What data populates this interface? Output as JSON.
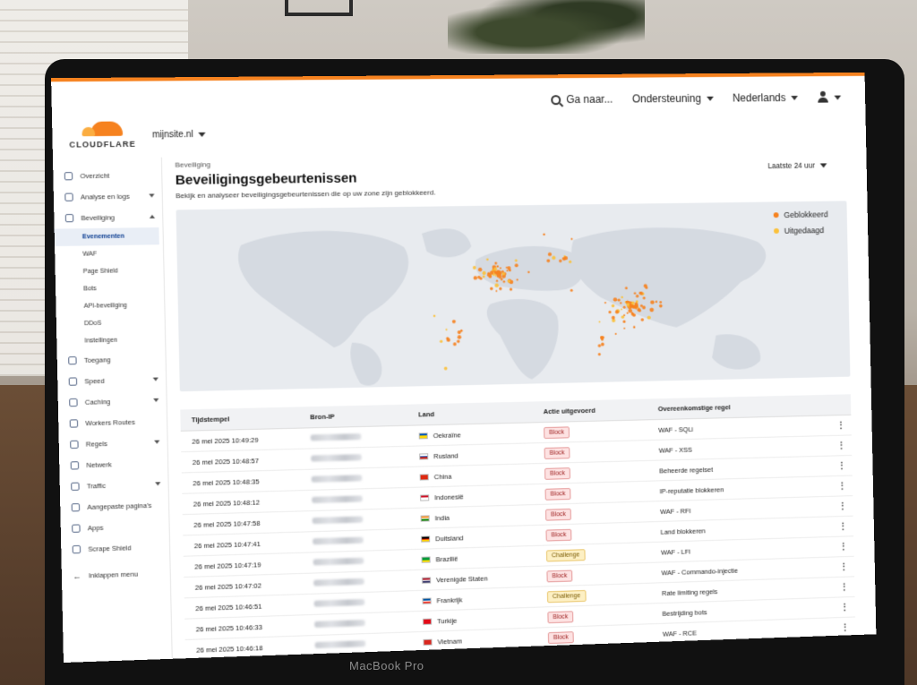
{
  "device": {
    "label": "MacBook Pro"
  },
  "header": {
    "goto": "Ga naar...",
    "support": "Ondersteuning",
    "language": "Nederlands"
  },
  "brand": {
    "name": "CLOUDFLARE",
    "zone": "mijnsite.nl"
  },
  "colors": {
    "accent": "#f6821f",
    "blocked": "#f6821f",
    "challenged": "#fbc13a"
  },
  "sidebar": {
    "items": [
      {
        "label": "Overzicht",
        "icon": "home-icon"
      },
      {
        "label": "Analyse en logs",
        "icon": "chart-icon",
        "expandable": true
      },
      {
        "label": "Beveiliging",
        "icon": "shield-icon",
        "expanded": true
      }
    ],
    "security_sub": [
      {
        "label": "Evenementen",
        "active": true
      },
      {
        "label": "WAF"
      },
      {
        "label": "Page Shield"
      },
      {
        "label": "Bots"
      },
      {
        "label": "API-beveiliging"
      },
      {
        "label": "DDoS"
      },
      {
        "label": "Instellingen"
      }
    ],
    "items2": [
      {
        "label": "Toegang",
        "icon": "access-icon"
      },
      {
        "label": "Speed",
        "icon": "lightning-icon",
        "expandable": true
      },
      {
        "label": "Caching",
        "icon": "cache-icon",
        "expandable": true
      },
      {
        "label": "Workers Routes",
        "icon": "workers-icon"
      },
      {
        "label": "Regels",
        "icon": "rules-icon",
        "expandable": true
      },
      {
        "label": "Netwerk",
        "icon": "network-icon"
      },
      {
        "label": "Traffic",
        "icon": "traffic-icon",
        "expandable": true
      },
      {
        "label": "Aangepaste pagina's",
        "icon": "wrench-icon"
      },
      {
        "label": "Apps",
        "icon": "apps-icon"
      },
      {
        "label": "Scrape Shield",
        "icon": "scrape-icon"
      }
    ],
    "collapse": "Inklappen menu"
  },
  "page": {
    "breadcrumb": "Beveiliging",
    "title": "Beveiligingsgebeurtenissen",
    "subtitle": "Bekijk en analyseer beveiligingsgebeurtenissen die op uw zone zijn geblokkeerd.",
    "time_range": "Laatste 24 uur"
  },
  "map": {
    "legend": [
      {
        "label": "Geblokkeerd",
        "color": "#f6821f"
      },
      {
        "label": "Uitgedaagd",
        "color": "#fbc13a"
      }
    ]
  },
  "table": {
    "columns": [
      "Tijdstempel",
      "Bron-IP",
      "Land",
      "Actie uitgevoerd",
      "Overeenkomstige regel"
    ],
    "rows": [
      {
        "time": "26 mei 2025 10:49:29",
        "country": "Oekraïne",
        "flag": [
          "#0057b7",
          "#ffd700"
        ],
        "action": "Block",
        "rule": "WAF - SQLi"
      },
      {
        "time": "26 mei 2025 10:48:57",
        "country": "Rusland",
        "flag": [
          "#ffffff",
          "#0039a6",
          "#d52b1e"
        ],
        "action": "Block",
        "rule": "WAF - XSS"
      },
      {
        "time": "26 mei 2025 10:48:35",
        "country": "China",
        "flag": [
          "#de2910"
        ],
        "action": "Block",
        "rule": "Beheerde regelset"
      },
      {
        "time": "26 mei 2025 10:48:12",
        "country": "Indonesië",
        "flag": [
          "#ce1126",
          "#ffffff"
        ],
        "action": "Block",
        "rule": "IP-reputatie blokkeren"
      },
      {
        "time": "26 mei 2025 10:47:58",
        "country": "India",
        "flag": [
          "#ff9933",
          "#ffffff",
          "#138808"
        ],
        "action": "Block",
        "rule": "WAF - RFI"
      },
      {
        "time": "26 mei 2025 10:47:41",
        "country": "Duitsland",
        "flag": [
          "#000000",
          "#dd0000",
          "#ffce00"
        ],
        "action": "Block",
        "rule": "Land blokkeren"
      },
      {
        "time": "26 mei 2025 10:47:19",
        "country": "Brazilië",
        "flag": [
          "#009c3b",
          "#ffdf00"
        ],
        "action": "Challenge",
        "rule": "WAF - LFI"
      },
      {
        "time": "26 mei 2025 10:47:02",
        "country": "Verenigde Staten",
        "flag": [
          "#b22234",
          "#ffffff",
          "#3c3b6e"
        ],
        "action": "Block",
        "rule": "WAF - Commando-injectie"
      },
      {
        "time": "26 mei 2025 10:46:51",
        "country": "Frankrijk",
        "flag": [
          "#0055a4",
          "#ffffff",
          "#ef4135"
        ],
        "action": "Challenge",
        "rule": "Rate limiting regels"
      },
      {
        "time": "26 mei 2025 10:46:33",
        "country": "Turkije",
        "flag": [
          "#e30a17"
        ],
        "action": "Block",
        "rule": "Bestrijding bots"
      },
      {
        "time": "26 mei 2025 10:46:18",
        "country": "Vietnam",
        "flag": [
          "#da251d"
        ],
        "action": "Block",
        "rule": "WAF - RCE"
      }
    ]
  }
}
